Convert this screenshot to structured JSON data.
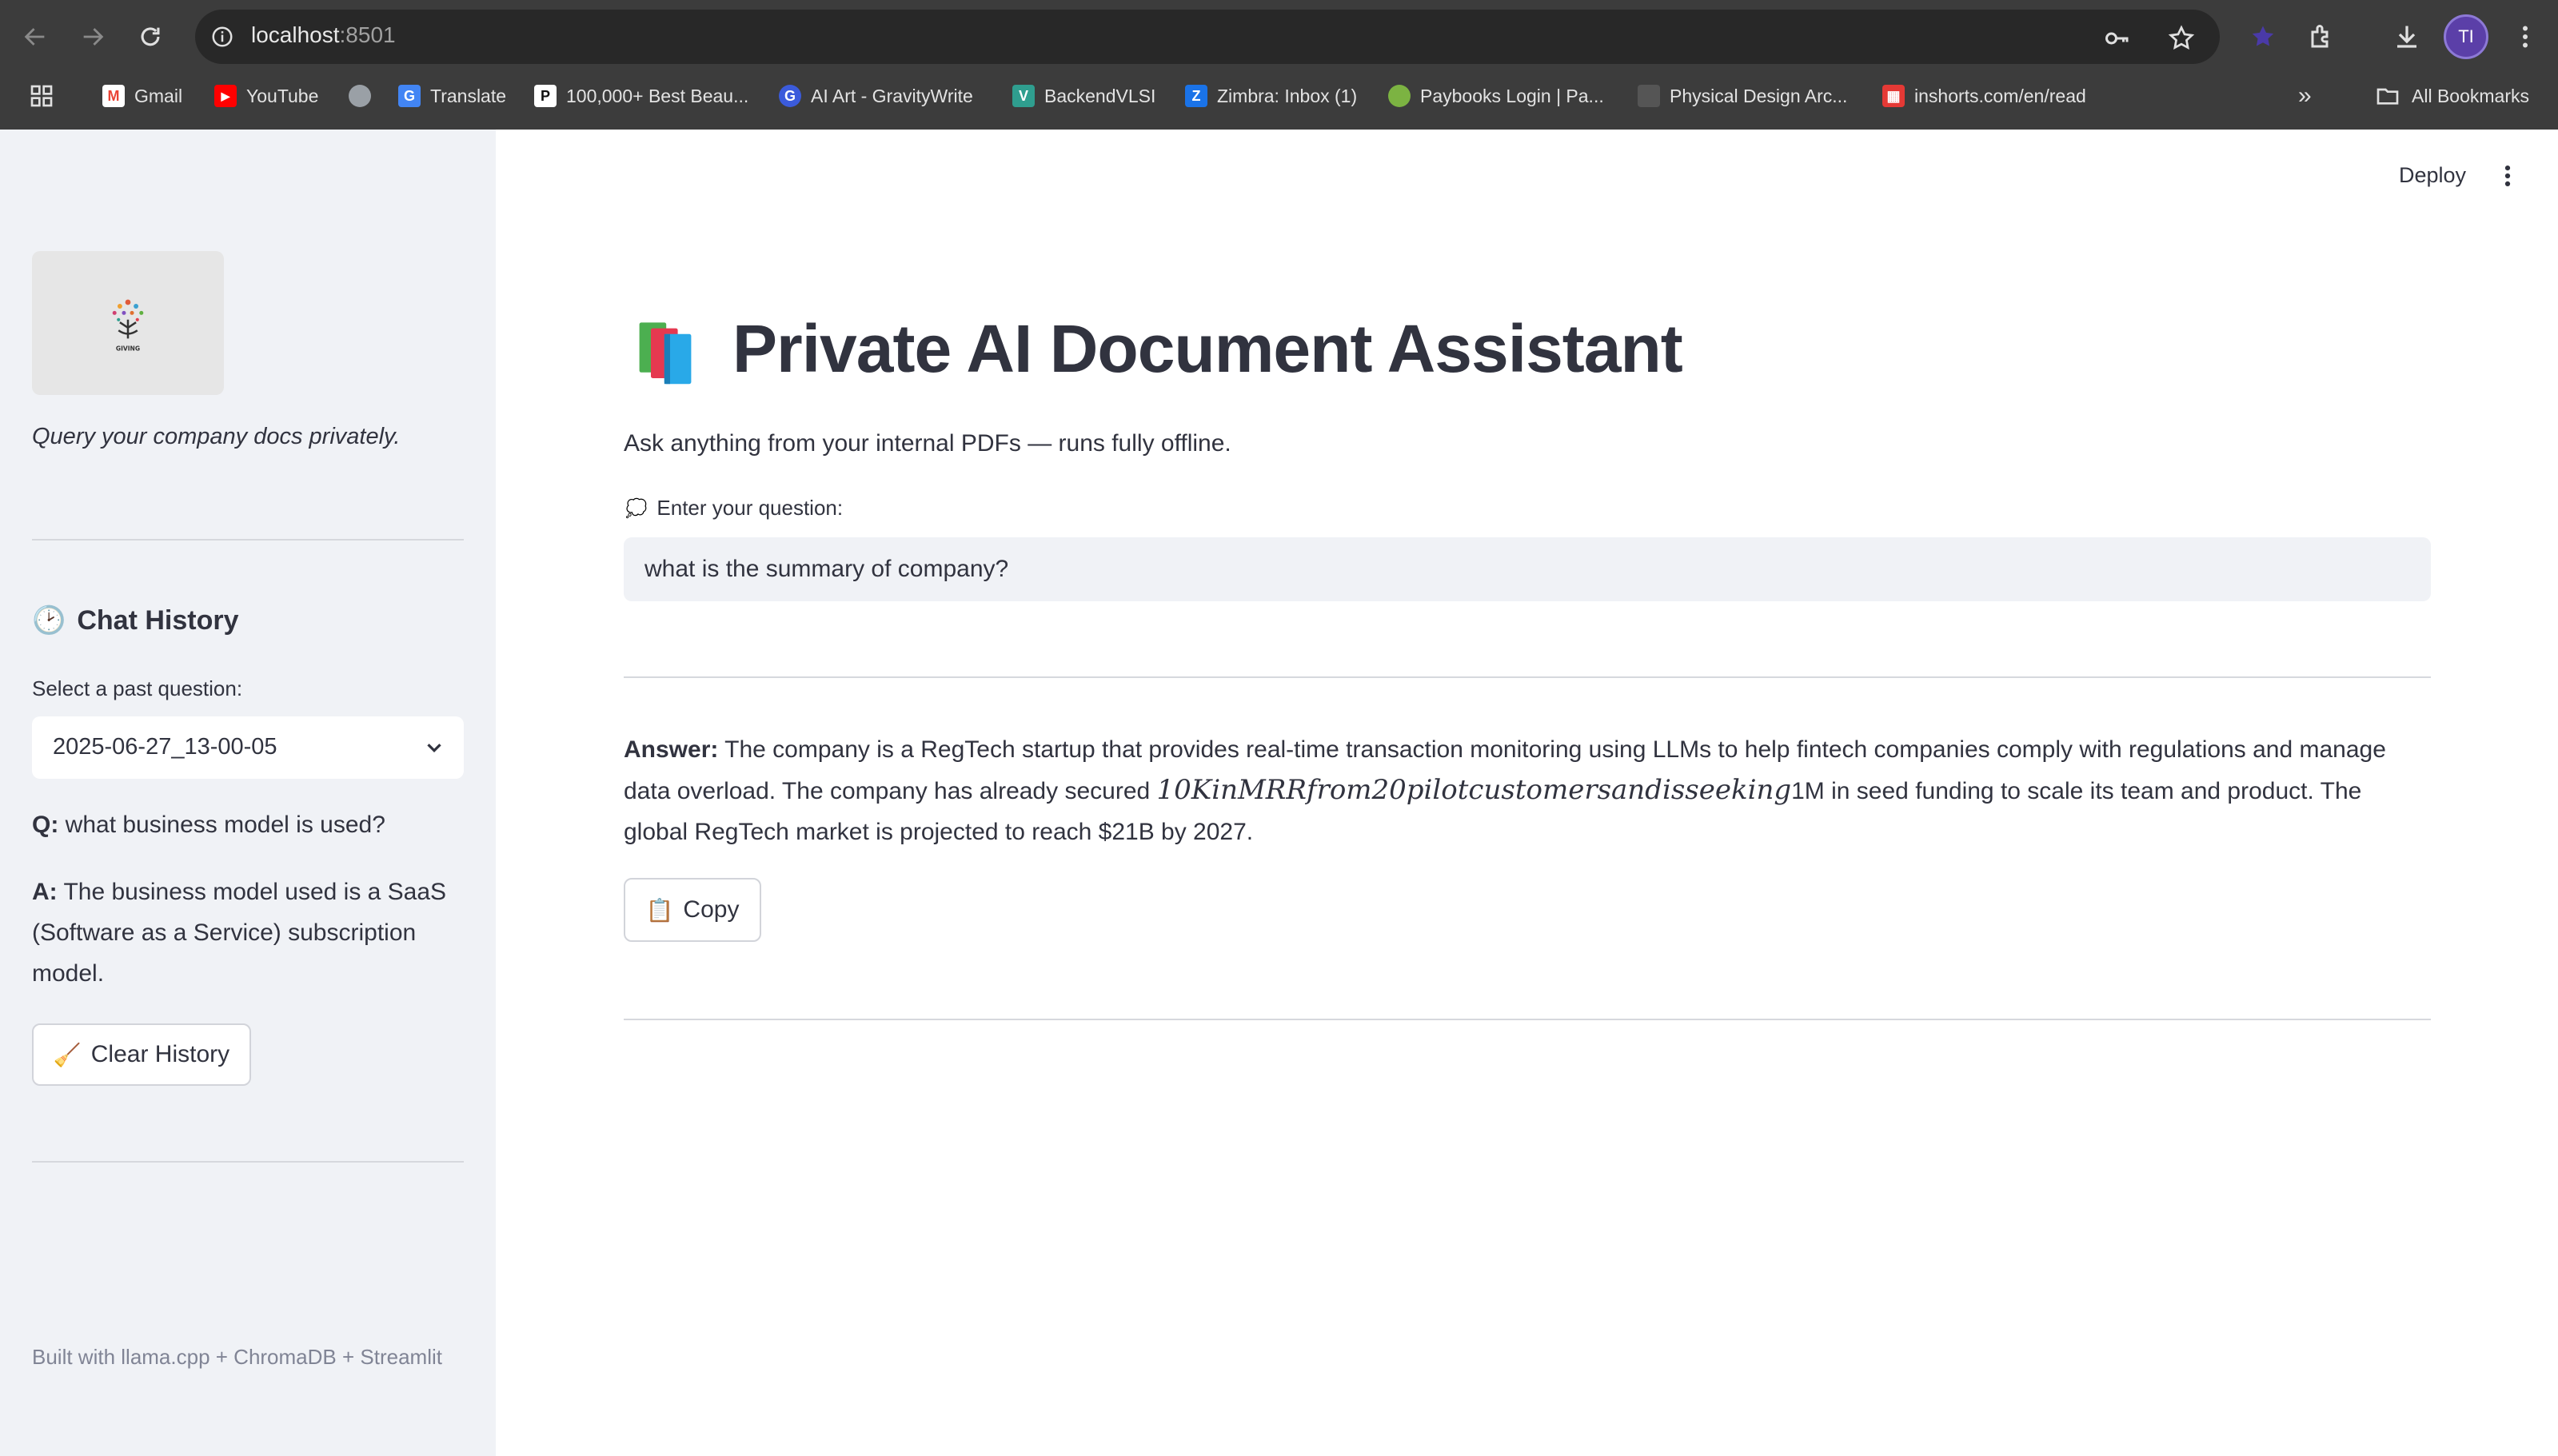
{
  "browser": {
    "url_host": "localhost",
    "url_port": ":8501",
    "avatar_initials": "TI",
    "bookmarks": [
      {
        "label": "Gmail",
        "icon": "gmail-icon",
        "color": "#ea4335"
      },
      {
        "label": "YouTube",
        "icon": "youtube-icon",
        "color": "#ff0000"
      },
      {
        "label": "",
        "icon": "globe-icon",
        "color": "#9aa0a6"
      },
      {
        "label": "Translate",
        "icon": "google-translate-icon",
        "color": "#4285f4"
      },
      {
        "label": "100,000+ Best Beau...",
        "icon": "pexels-icon",
        "color": "#111111"
      },
      {
        "label": "AI Art - GravityWrite",
        "icon": "gravitywrite-icon",
        "color": "#3b5bdb"
      },
      {
        "label": "BackendVLSI",
        "icon": "backendvlsi-icon",
        "color": "#2f9e8f"
      },
      {
        "label": "Zimbra: Inbox (1)",
        "icon": "zimbra-icon",
        "color": "#1a73e8"
      },
      {
        "label": "Paybooks Login | Pa...",
        "icon": "paybooks-icon",
        "color": "#7cb342"
      },
      {
        "label": "Physical Design Arc...",
        "icon": "document-icon",
        "color": "#555555"
      },
      {
        "label": "inshorts.com/en/read",
        "icon": "inshorts-icon",
        "color": "#e53935"
      }
    ],
    "all_bookmarks_label": "All Bookmarks"
  },
  "sidebar": {
    "logo_text": "GIVING",
    "tagline": "Query your company docs privately.",
    "history_heading": "Chat History",
    "history_icon": "clock-emoji",
    "select_label": "Select a past question:",
    "selected_value": "2025-06-27_13-00-05",
    "q_prefix": "Q:",
    "question": "what business model is used?",
    "a_prefix": "A:",
    "answer": "The business model used is a SaaS (Software as a Service) subscription model.",
    "clear_button": "Clear History",
    "footer": "Built with llama.cpp + ChromaDB + Streamlit"
  },
  "header": {
    "deploy_label": "Deploy"
  },
  "main": {
    "title": "Private AI Document Assistant",
    "title_icon": "books-emoji",
    "subtitle": "Ask anything from your internal PDFs — runs fully offline.",
    "question_label": "Enter your question:",
    "question_value": "what is the summary of company?",
    "answer_prefix": "Answer:",
    "answer_part1": " The company is a RegTech startup that provides real-time transaction monitoring using LLMs to help fintech companies comply with regulations and manage data overload. The company has already secured ",
    "answer_math": "10KinMRRfrom20pilotcustomersandisseeking",
    "answer_part2": "1M in seed funding to scale its team and product. The global RegTech market is projected to reach $21B by 2027.",
    "copy_button": "Copy"
  }
}
